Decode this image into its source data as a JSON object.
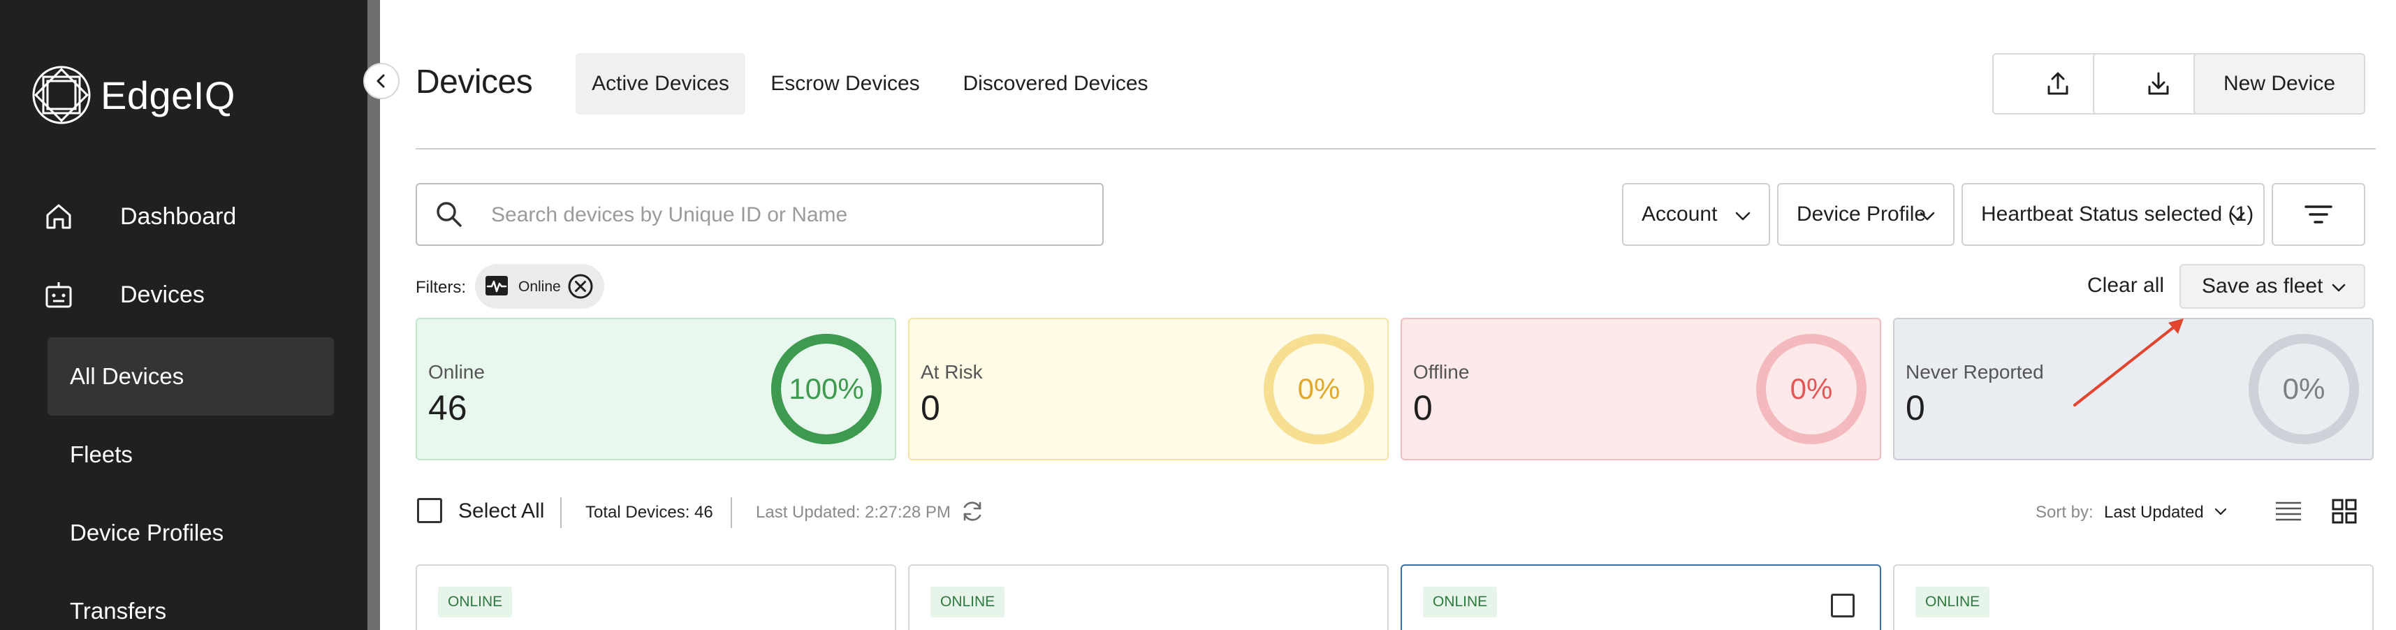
{
  "app": {
    "name": "EdgeIQ"
  },
  "sidebar": {
    "items": [
      {
        "label": "Dashboard",
        "icon": "home-icon"
      },
      {
        "label": "Devices",
        "icon": "device-icon"
      }
    ],
    "sub_items": [
      {
        "label": "All Devices",
        "active": true
      },
      {
        "label": "Fleets",
        "active": false
      },
      {
        "label": "Device Profiles",
        "active": false
      },
      {
        "label": "Transfers",
        "active": false
      }
    ]
  },
  "header": {
    "title": "Devices",
    "tabs": [
      {
        "label": "Active Devices",
        "active": true
      },
      {
        "label": "Escrow Devices",
        "active": false
      },
      {
        "label": "Discovered Devices",
        "active": false
      }
    ],
    "upload_icon": "upload-icon",
    "download_icon": "download-icon",
    "new_device_label": "New Device"
  },
  "search": {
    "placeholder": "Search devices by Unique ID or Name",
    "value": ""
  },
  "dropdowns": {
    "account": "Account",
    "device_profile": "Device Profile",
    "heartbeat": "Heartbeat Status selected (1)"
  },
  "filters": {
    "label": "Filters:",
    "chips": [
      {
        "label": "Online",
        "icon": "heartbeat-icon"
      }
    ],
    "clear_all": "Clear all",
    "save_as_fleet": "Save as fleet"
  },
  "stats": [
    {
      "label": "Online",
      "value": "46",
      "percent_text": "100%",
      "fraction": 1.0,
      "color": "#3d9a4f",
      "bg": "#e9f8ee",
      "border": "#bfe6c9",
      "track": "#3d9a4f"
    },
    {
      "label": "At Risk",
      "value": "0",
      "percent_text": "0%",
      "fraction": 0.0,
      "color": "#e0a92e",
      "bg": "#fffbe6",
      "border": "#f3e3a3",
      "track": "#f7df92"
    },
    {
      "label": "Offline",
      "value": "0",
      "percent_text": "0%",
      "fraction": 0.0,
      "color": "#e45757",
      "bg": "#fde9ea",
      "border": "#f3bcbf",
      "track": "#f4b9bc"
    },
    {
      "label": "Never Reported",
      "value": "0",
      "percent_text": "0%",
      "fraction": 0.0,
      "color": "#7a7f86",
      "bg": "#e9ecf0",
      "border": "#c9ced5",
      "track": "#cdd2d8"
    }
  ],
  "list_toolbar": {
    "select_all": "Select All",
    "total_devices": "Total Devices: 46",
    "last_updated": "Last Updated: 2:27:28 PM",
    "sort_label": "Sort by:",
    "sort_value": "Last Updated"
  },
  "device_cards": [
    {
      "status": "ONLINE",
      "selected": false
    },
    {
      "status": "ONLINE",
      "selected": false
    },
    {
      "status": "ONLINE",
      "selected": true
    },
    {
      "status": "ONLINE",
      "selected": false
    }
  ],
  "colors": {
    "sidebar_bg": "#1f2020",
    "active_nav_bg": "#333435",
    "arrow": "#e2452f",
    "selected_border": "#3a6ea5"
  }
}
